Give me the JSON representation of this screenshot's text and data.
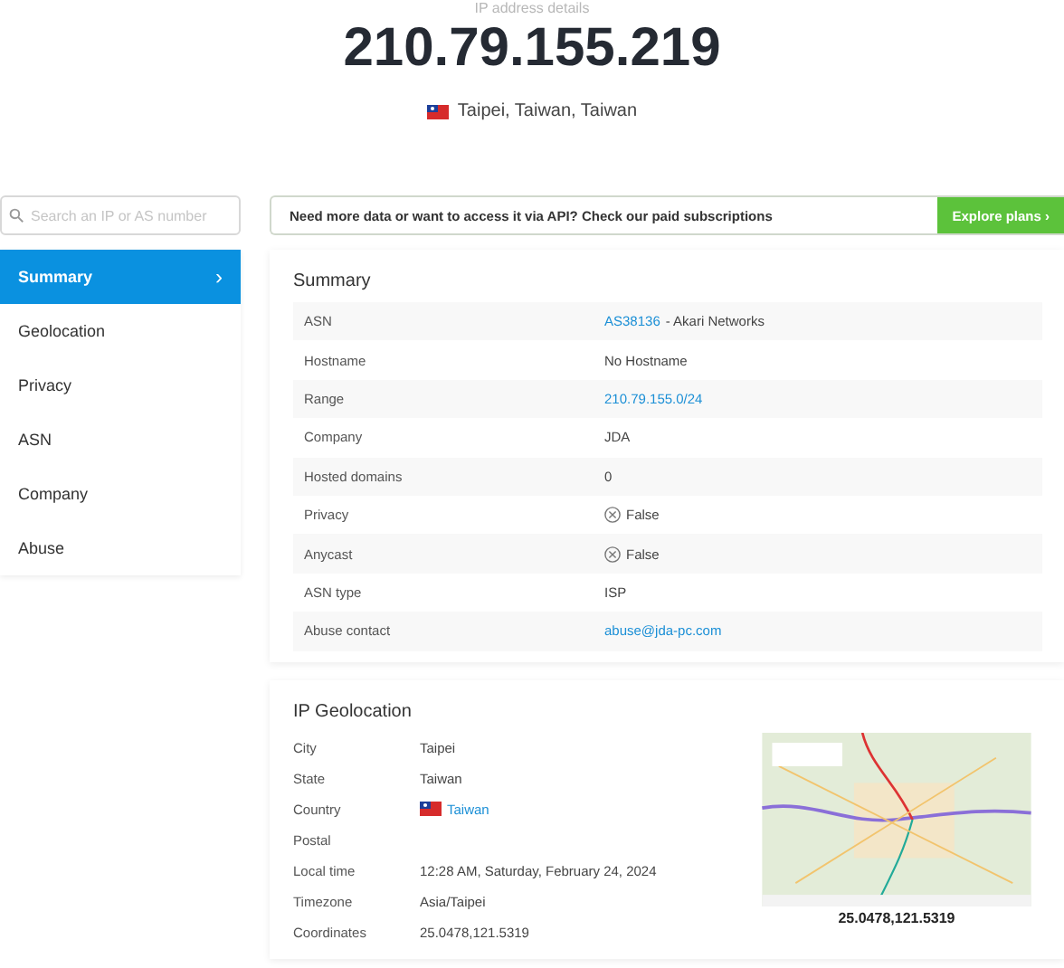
{
  "header": {
    "subtitle": "IP address details",
    "ip": "210.79.155.219",
    "location": "Taipei, Taiwan, Taiwan"
  },
  "search": {
    "placeholder": "Search an IP or AS number"
  },
  "banner": {
    "text": "Need more data or want to access it via API? Check our paid subscriptions",
    "button": "Explore plans ›"
  },
  "sidebar": {
    "items": [
      {
        "label": "Summary",
        "selected": true,
        "chevron": "›"
      },
      {
        "label": "Geolocation",
        "selected": false
      },
      {
        "label": "Privacy",
        "selected": false
      },
      {
        "label": "ASN",
        "selected": false
      },
      {
        "label": "Company",
        "selected": false
      },
      {
        "label": "Abuse",
        "selected": false
      }
    ]
  },
  "summary": {
    "title": "Summary",
    "rows": [
      {
        "label": "ASN",
        "kind": "link_suffix",
        "link": "AS38136",
        "value": " - Akari Networks"
      },
      {
        "label": "Hostname",
        "kind": "text",
        "value": "No Hostname"
      },
      {
        "label": "Range",
        "kind": "link",
        "link": "210.79.155.0/24"
      },
      {
        "label": "Company",
        "kind": "text",
        "value": "JDA"
      },
      {
        "label": "Hosted domains",
        "kind": "text",
        "value": "0"
      },
      {
        "label": "Privacy",
        "kind": "bool",
        "value": "False"
      },
      {
        "label": "Anycast",
        "kind": "bool",
        "value": "False"
      },
      {
        "label": "ASN type",
        "kind": "text",
        "value": "ISP"
      },
      {
        "label": "Abuse contact",
        "kind": "link",
        "link": "abuse@jda-pc.com"
      }
    ]
  },
  "geolocation": {
    "title": "IP Geolocation",
    "rows": [
      {
        "label": "City",
        "kind": "text",
        "value": "Taipei"
      },
      {
        "label": "State",
        "kind": "text",
        "value": "Taiwan"
      },
      {
        "label": "Country",
        "kind": "flag_link",
        "link": "Taiwan"
      },
      {
        "label": "Postal",
        "kind": "text",
        "value": ""
      },
      {
        "label": "Local time",
        "kind": "text",
        "value": "12:28 AM, Saturday, February 24, 2024"
      },
      {
        "label": "Timezone",
        "kind": "text",
        "value": "Asia/Taipei"
      },
      {
        "label": "Coordinates",
        "kind": "text",
        "value": "25.0478,121.5319"
      }
    ],
    "map_caption": "25.0478,121.5319"
  }
}
